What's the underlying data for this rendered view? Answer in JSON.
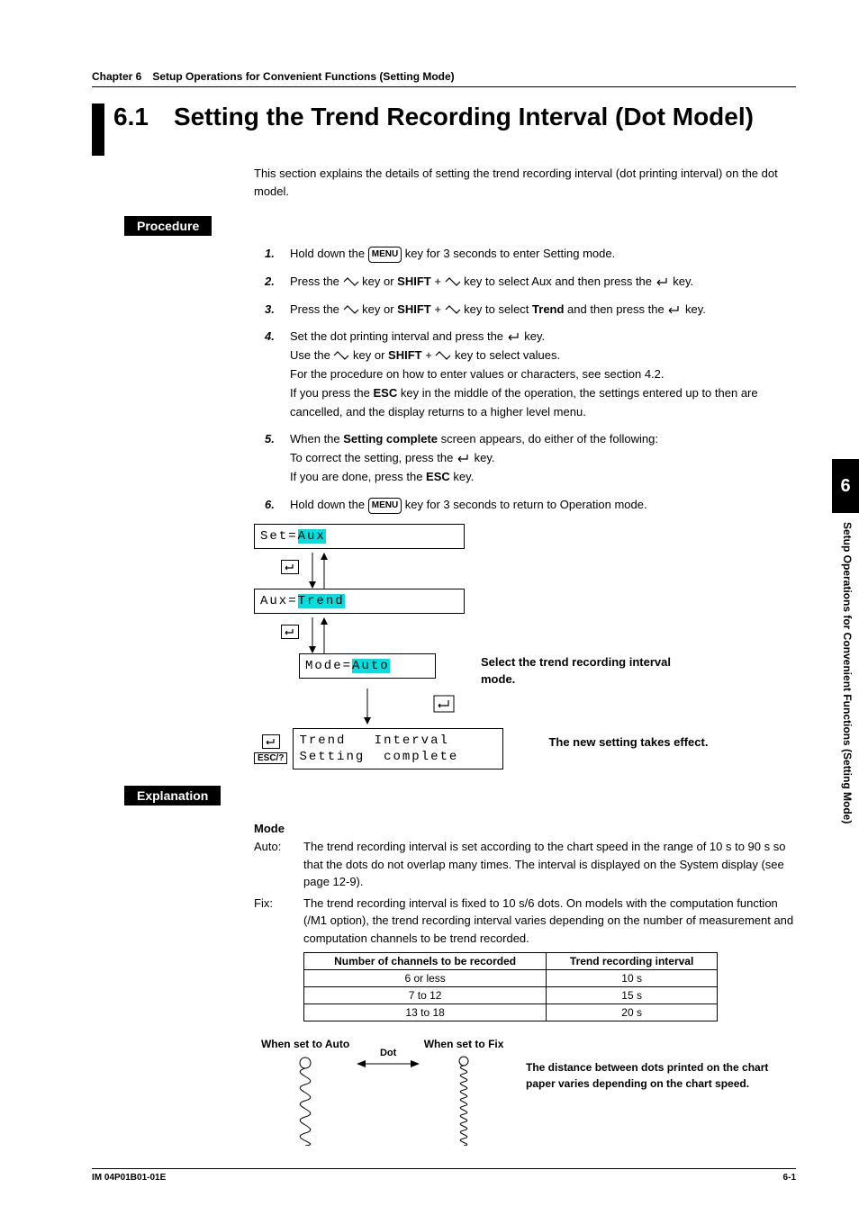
{
  "chapter_head": "Chapter 6 Setup Operations for Convenient Functions (Setting Mode)",
  "section": {
    "number": "6.1",
    "title": "Setting the Trend Recording Interval (Dot Model)"
  },
  "intro": "This section explains the details of setting the trend recording interval (dot printing interval) on the dot model.",
  "labels": {
    "procedure": "Procedure",
    "explanation": "Explanation"
  },
  "inline": {
    "shift": "SHIFT",
    "trend": "Trend",
    "esc_key": "ESC",
    "setting_complete": "Setting complete",
    "menu_key": "MENU"
  },
  "steps": {
    "s1": {
      "num": "1.",
      "a": "Hold down the ",
      "b": " key for 3 seconds to enter Setting mode."
    },
    "s2": {
      "num": "2.",
      "a": "Press the ",
      "b": " key or ",
      "c": " + ",
      "d": " key to select Aux and then press the ",
      "e": " key."
    },
    "s3": {
      "num": "3.",
      "a": "Press the ",
      "b": " key or ",
      "c": " + ",
      "d": " key to select ",
      "e": " and then press the ",
      "f": " key."
    },
    "s4": {
      "num": "4.",
      "l1a": "Set the dot printing interval and press the ",
      "l1b": " key.",
      "l2a": "Use the ",
      "l2b": " key or ",
      "l2c": " + ",
      "l2d": " key to select values.",
      "l3": "For the procedure on how to enter values or characters, see section 4.2.",
      "l4a": "If you press the ",
      "l4b": " key in the middle of the operation, the settings entered up to then are cancelled, and the display returns to a higher level menu."
    },
    "s5": {
      "num": "5.",
      "l1a": "When the ",
      "l1b": " screen appears, do either of the following:",
      "l2a": "To correct the setting, press the ",
      "l2b": " key.",
      "l3a": "If you are done, press the ",
      "l3b": " key."
    },
    "s6": {
      "num": "6.",
      "a": "Hold down the ",
      "b": " key for 3 seconds to return to Operation mode."
    }
  },
  "diagram": {
    "set_prefix": "Set=",
    "set_val": "Aux",
    "aux_prefix": "Aux=",
    "aux_val": "Trend",
    "mode_prefix": "Mode=",
    "mode_val": "Auto",
    "final_line1": "Trend   Interval",
    "final_line2": "Setting  complete",
    "note1": "Select the trend recording interval mode.",
    "note2": "The new setting takes effect.",
    "esc_label": "ESC/?"
  },
  "explanation": {
    "mode_head": "Mode",
    "auto_label": "Auto:",
    "auto_text": "The trend recording interval is set according to the chart speed in the range of 10 s to 90 s so that the dots do not overlap many times. The interval is displayed on the System display (see page 12-9).",
    "fix_label": "Fix:",
    "fix_text": "The trend recording interval is fixed to 10 s/6 dots. On models with the computation function (/M1 option), the trend recording interval varies depending on the number of measurement and computation channels to be trend recorded.",
    "table": {
      "h1": "Number of channels to be recorded",
      "h2": "Trend recording interval",
      "r1c1": "6 or less",
      "r1c2": "10 s",
      "r2c1": "7 to 12",
      "r2c2": "15 s",
      "r3c1": "13 to 18",
      "r3c2": "20 s"
    },
    "dot_auto_head": "When set to Auto",
    "dot_fix_head": "When set to Fix",
    "dot_label": "Dot",
    "dot_note": "The distance between dots printed on the chart paper varies depending on the chart speed."
  },
  "side": {
    "chapter_num": "6",
    "side_text": "Setup Operations for Convenient Functions (Setting Mode)"
  },
  "footer": {
    "left": "IM 04P01B01-01E",
    "right": "6-1"
  }
}
